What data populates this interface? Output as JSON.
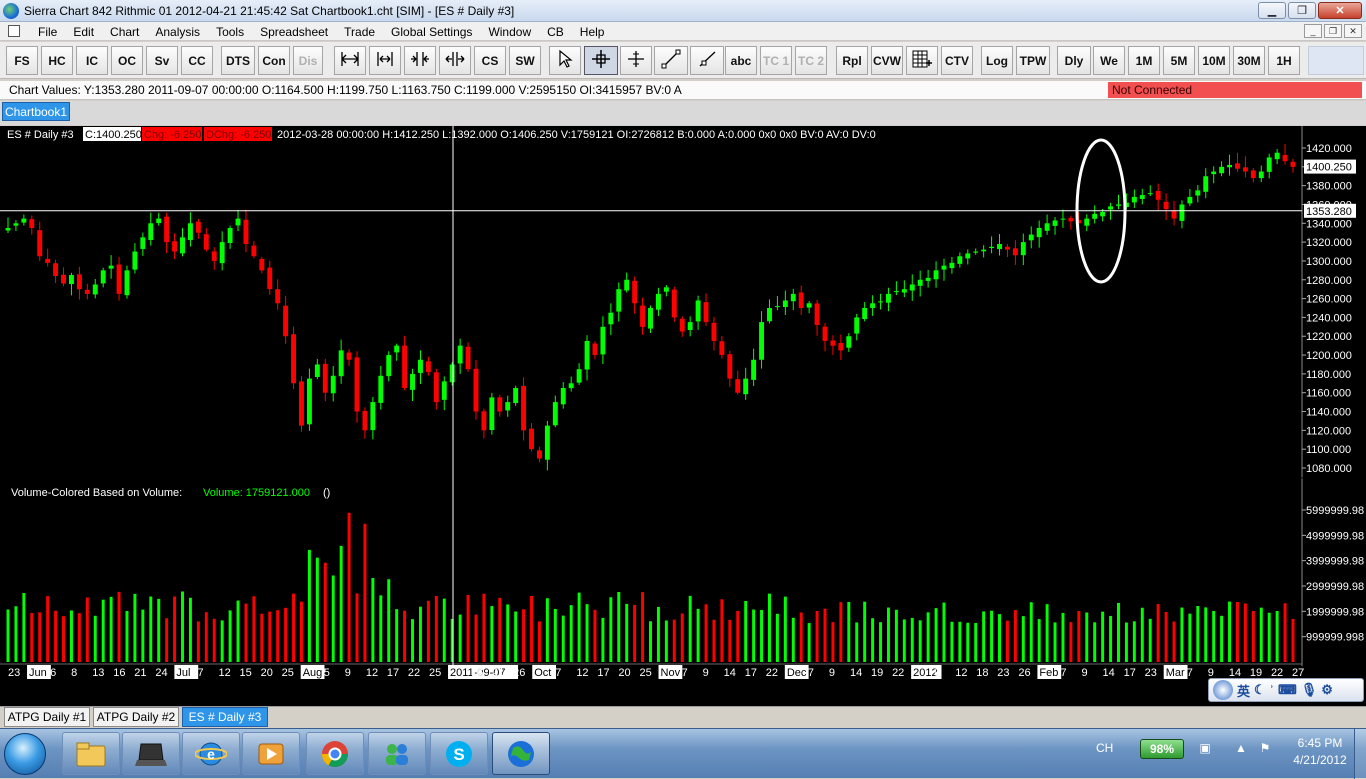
{
  "window": {
    "title": "Sierra Chart 842 Rithmic 01 2012-04-21  21:45:42 Sat  Chartbook1.cht [SIM] - [ES #  Daily  #3]",
    "buttons": [
      "minimize",
      "restore",
      "close"
    ]
  },
  "menu": {
    "items": [
      "File",
      "Edit",
      "Chart",
      "Analysis",
      "Tools",
      "Spreadsheet",
      "Trade",
      "Global Settings",
      "Window",
      "CB",
      "Help"
    ]
  },
  "toolbar": {
    "buttons": [
      {
        "label": "FS"
      },
      {
        "label": "HC"
      },
      {
        "label": "IC"
      },
      {
        "label": "OC"
      },
      {
        "label": "Sv"
      },
      {
        "label": "CC"
      },
      {
        "label": "DTS"
      },
      {
        "label": "Con"
      },
      {
        "label": "Dis",
        "disabled": true
      },
      {
        "icon": "scale-horizontal-icon"
      },
      {
        "icon": "scale-width-icon"
      },
      {
        "icon": "bar-spacing-decrease-icon"
      },
      {
        "icon": "bar-spacing-increase-icon"
      },
      {
        "label": "CS"
      },
      {
        "label": "SW"
      },
      {
        "icon": "pointer-icon"
      },
      {
        "icon": "crosshair-icon",
        "active": true
      },
      {
        "icon": "value-cursor-icon"
      },
      {
        "icon": "line-tool-icon"
      },
      {
        "icon": "ray-tool-icon"
      },
      {
        "label": "abc"
      },
      {
        "label": "TC 1",
        "disabled": true
      },
      {
        "label": "TC 2",
        "disabled": true
      },
      {
        "label": "Rpl"
      },
      {
        "label": "CVW"
      },
      {
        "icon": "trade-dom-icon"
      },
      {
        "label": "CTV"
      },
      {
        "label": "Log"
      },
      {
        "label": "TPW"
      },
      {
        "label": "Dly"
      },
      {
        "label": "We"
      },
      {
        "label": "1M"
      },
      {
        "label": "5M"
      },
      {
        "label": "10M"
      },
      {
        "label": "30M"
      },
      {
        "label": "1H"
      }
    ]
  },
  "status": {
    "chart_values": "Chart Values: Y:1353.280  2011-09-07  00:00:00   O:1164.500  H:1199.750  L:1163.750  C:1199.000  V:2595150  OI:3415957  BV:0  A",
    "connection": "Not Connected"
  },
  "chartbook_tab": "Chartbook1",
  "chart": {
    "header": {
      "symbol": "ES #  Daily  #3",
      "close": "C:1400.250",
      "chg": "Chg: -6.250",
      "dchg": "DChg: -6.250",
      "rest": "2012-03-28 00:00:00  H:1412.250  L:1392.000  O:1406.250  V:1759121  OI:2726812  B:0.000  A:0.000  0x0  0x0  BV:0  AV:0  DV:0"
    },
    "price_labels": [
      "1420.000",
      "1400.000",
      "1380.000",
      "1360.000",
      "1340.000",
      "1320.000",
      "1300.000",
      "1280.000",
      "1260.000",
      "1240.000",
      "1220.000",
      "1200.000",
      "1180.000",
      "1160.000",
      "1140.000",
      "1120.000",
      "1100.000",
      "1080.000"
    ],
    "last_price_label": "1400.250",
    "cursor_price_label": "1353.280",
    "volume_header": {
      "title": "Volume-Colored Based on Volume:",
      "value": "Volume: 1759121.000",
      "extra": "()"
    },
    "volume_labels": [
      "5999999.98",
      "4999999.98",
      "3999999.98",
      "2999999.98",
      "1999999.98",
      "999999.998"
    ],
    "date_labels": [
      "23",
      "Jun",
      "6",
      "8",
      "13",
      "16",
      "21",
      "24",
      "Jul",
      "7",
      "12",
      "15",
      "20",
      "25",
      "Aug",
      "5",
      "9",
      "12",
      "17",
      "22",
      "25",
      "2011-09-07",
      "16",
      "21",
      "26",
      "Oct",
      "7",
      "12",
      "17",
      "20",
      "25",
      "Nov",
      "7",
      "9",
      "14",
      "17",
      "22",
      "Dec",
      "7",
      "9",
      "14",
      "19",
      "22",
      "2012",
      "9",
      "12",
      "18",
      "23",
      "26",
      "Feb",
      "7",
      "9",
      "14",
      "17",
      "23",
      "Mar",
      "7",
      "9",
      "14",
      "19",
      "22",
      "27"
    ],
    "chart_data": {
      "type": "candlestick",
      "symbol": "ES #",
      "interval": "Daily",
      "ylim": [
        1070,
        1430
      ],
      "x_range": [
        "2011-05-23",
        "2012-03-28"
      ],
      "price_path": [
        1335,
        1340,
        1345,
        1335,
        1305,
        1298,
        1284,
        1276,
        1285,
        1270,
        1265,
        1275,
        1290,
        1295,
        1265,
        1290,
        1310,
        1325,
        1340,
        1345,
        1320,
        1310,
        1325,
        1340,
        1330,
        1312,
        1300,
        1320,
        1335,
        1345,
        1318,
        1305,
        1290,
        1270,
        1255,
        1220,
        1170,
        1125,
        1175,
        1190,
        1160,
        1178,
        1205,
        1195,
        1140,
        1120,
        1150,
        1178,
        1200,
        1210,
        1165,
        1180,
        1195,
        1182,
        1150,
        1172,
        1190,
        1210,
        1185,
        1140,
        1120,
        1155,
        1140,
        1150,
        1165,
        1120,
        1100,
        1090,
        1125,
        1150,
        1165,
        1170,
        1185,
        1215,
        1200,
        1230,
        1245,
        1270,
        1280,
        1255,
        1230,
        1250,
        1265,
        1272,
        1240,
        1225,
        1235,
        1258,
        1235,
        1215,
        1200,
        1175,
        1160,
        1175,
        1195,
        1235,
        1250,
        1252,
        1258,
        1265,
        1250,
        1255,
        1232,
        1215,
        1210,
        1205,
        1220,
        1240,
        1250,
        1255,
        1257,
        1265,
        1268,
        1270,
        1275,
        1280,
        1282,
        1290,
        1295,
        1298,
        1305,
        1308,
        1310,
        1312,
        1315,
        1318,
        1312,
        1306,
        1320,
        1328,
        1335,
        1340,
        1343,
        1345,
        1342,
        1340,
        1345,
        1350,
        1352,
        1358,
        1360,
        1362,
        1368,
        1370,
        1372,
        1365,
        1355,
        1345,
        1360,
        1368,
        1375,
        1390,
        1395,
        1400,
        1402,
        1398,
        1395,
        1388,
        1395,
        1410,
        1415,
        1406,
        1400
      ],
      "volume_scale_max": 6000000,
      "annotations": [
        {
          "type": "ellipse",
          "note": "white oval around early-February consolidation near 1345"
        }
      ],
      "cursor": {
        "date": "2011-09-07",
        "price": 1353.28
      },
      "last_price": 1400.25,
      "colors": {
        "up": "#00ff00",
        "down": "#ff0000",
        "background": "#000000",
        "cursor": "#ffffff",
        "chg_bg": "#ff0000"
      }
    }
  },
  "chart_tabs": [
    "ATPG  Daily  #1",
    "ATPG  Daily  #2",
    "ES #  Daily  #3"
  ],
  "ime": {
    "labels": [
      "英",
      "☾",
      "ʾ"
    ]
  },
  "taskbar": {
    "apps": [
      "explorer-icon",
      "laptop-icon",
      "internet-explorer-icon",
      "media-player-icon",
      "chrome-icon",
      "messenger-icon",
      "skype-icon",
      "sierra-chart-icon"
    ],
    "tray_lang": "CH",
    "battery": "98%",
    "time": "6:45 PM",
    "date": "4/21/2012"
  }
}
